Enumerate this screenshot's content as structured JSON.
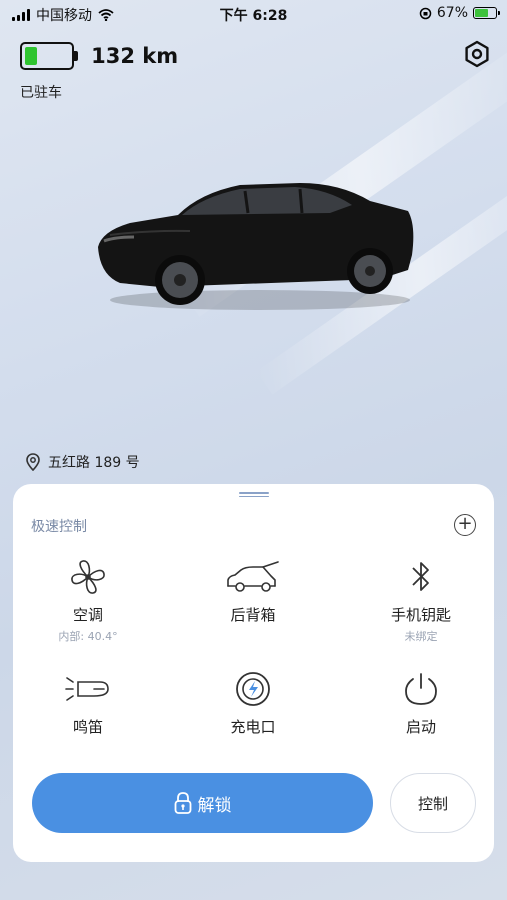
{
  "status_bar": {
    "carrier": "中国移动",
    "time": "下午 6:28",
    "battery_percent": "67%",
    "battery_level": 0.67
  },
  "vehicle": {
    "battery_level": 0.35,
    "range": "132 km",
    "state": "已驻车",
    "location": "五红路 189 号"
  },
  "quick_controls": {
    "title": "极速控制",
    "items": [
      {
        "label": "空调",
        "sub": "内部: 40.4°",
        "icon": "fan-icon"
      },
      {
        "label": "后背箱",
        "sub": "",
        "icon": "trunk-icon"
      },
      {
        "label": "手机钥匙",
        "sub": "未绑定",
        "icon": "bluetooth-icon"
      },
      {
        "label": "鸣笛",
        "sub": "",
        "icon": "horn-icon"
      },
      {
        "label": "充电口",
        "sub": "",
        "icon": "charge-port-icon"
      },
      {
        "label": "启动",
        "sub": "",
        "icon": "power-icon"
      }
    ]
  },
  "actions": {
    "unlock": "解锁",
    "control": "控制"
  },
  "colors": {
    "accent": "#4a90e2",
    "battery_green": "#2fc430",
    "muted": "#7a8aa6"
  }
}
